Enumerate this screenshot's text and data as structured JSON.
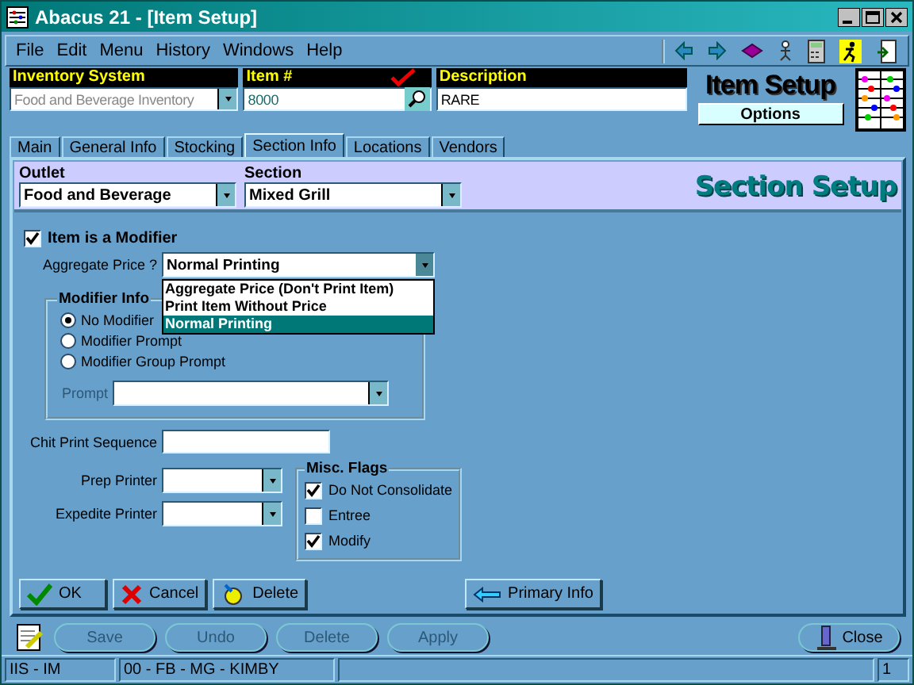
{
  "window": {
    "title": "Abacus 21 - [Item Setup]"
  },
  "menu": [
    "File",
    "Edit",
    "Menu",
    "History",
    "Windows",
    "Help"
  ],
  "header": {
    "inventory_system": {
      "label": "Inventory System",
      "value": "Food and Beverage Inventory"
    },
    "item": {
      "label": "Item #",
      "value": "8000"
    },
    "description": {
      "label": "Description",
      "value": "RARE"
    },
    "title": "Item Setup",
    "options_button": "Options"
  },
  "tabs": [
    {
      "label": "Main",
      "selected": false
    },
    {
      "label": "General Info",
      "selected": false
    },
    {
      "label": "Stocking",
      "selected": false
    },
    {
      "label": "Section Info",
      "selected": true
    },
    {
      "label": "Locations",
      "selected": false
    },
    {
      "label": "Vendors",
      "selected": false
    }
  ],
  "section_band": {
    "outlet": {
      "label": "Outlet",
      "value": "Food and Beverage"
    },
    "section": {
      "label": "Section",
      "value": "Mixed Grill"
    },
    "title": "Section Setup"
  },
  "is_modifier": {
    "label": "Item is a Modifier",
    "checked": true
  },
  "aggregate_price": {
    "label": "Aggregate Price ?",
    "value": "Normal Printing",
    "expanded": true,
    "options": [
      {
        "label": "Aggregate Price (Don't Print Item)",
        "selected": false
      },
      {
        "label": "Print Item Without Price",
        "selected": false
      },
      {
        "label": "Normal Printing",
        "selected": true
      }
    ]
  },
  "modifier_info": {
    "title": "Modifier Info",
    "options": [
      {
        "label": "No Modifier",
        "selected": true
      },
      {
        "label": "Modifier Prompt",
        "selected": false
      },
      {
        "label": "Modifier Group Prompt",
        "selected": false
      }
    ],
    "prompt": {
      "label": "Prompt",
      "disabled": true
    }
  },
  "chit_print_sequence": {
    "label": "Chit Print Sequence"
  },
  "prep_printer": {
    "label": "Prep Printer"
  },
  "expedite_printer": {
    "label": "Expedite Printer"
  },
  "misc_flags": {
    "title": "Misc. Flags",
    "flags": [
      {
        "label": "Do Not Consolidate",
        "checked": true
      },
      {
        "label": "Entree",
        "checked": false
      },
      {
        "label": "Modify",
        "checked": true
      }
    ]
  },
  "actions": [
    {
      "label": "OK",
      "kind": "ok"
    },
    {
      "label": "Cancel",
      "kind": "cancel"
    },
    {
      "label": "Delete",
      "kind": "delete"
    }
  ],
  "primary_info_button": "Primary Info",
  "bottom_toolbar": [
    {
      "label": "Save",
      "disabled": true
    },
    {
      "label": "Undo",
      "disabled": true
    },
    {
      "label": "Delete",
      "disabled": true
    },
    {
      "label": "Apply",
      "disabled": true
    }
  ],
  "close_button": "Close",
  "status_bar": [
    "IIS - IM",
    "00 - FB - MG - KIMBY",
    "1"
  ]
}
